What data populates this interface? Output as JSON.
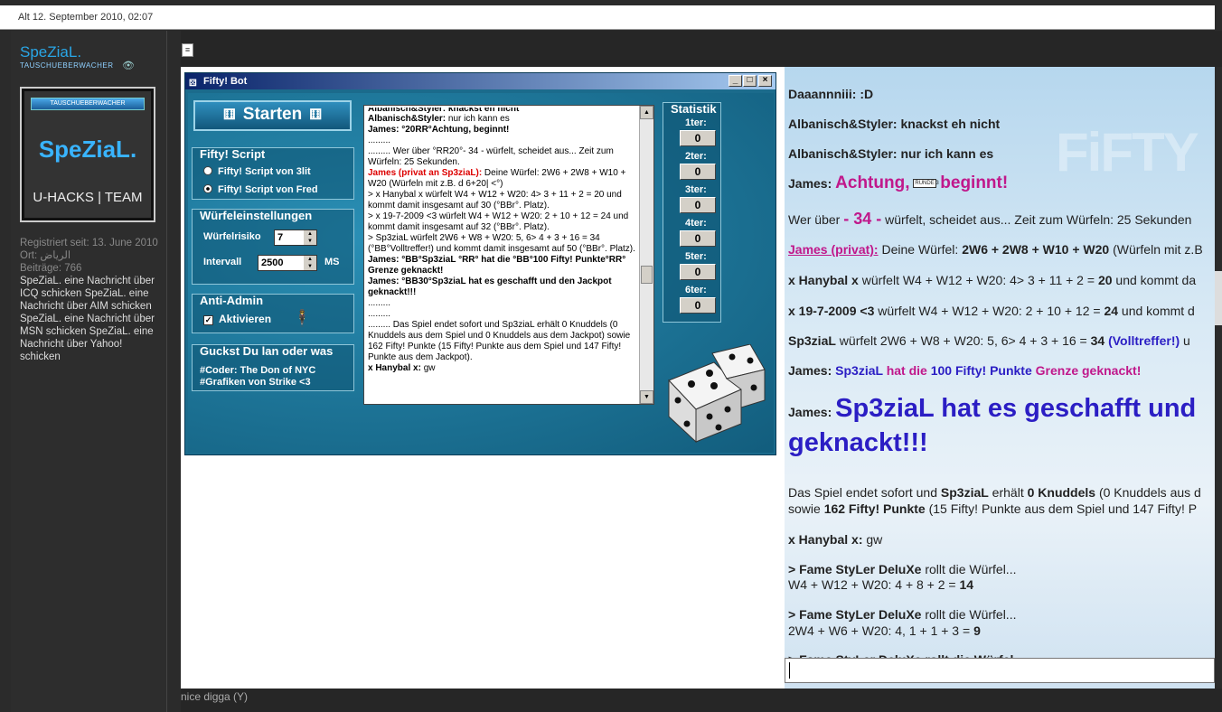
{
  "post": {
    "date": "Alt 12. September 2010, 02:07",
    "signature": "nice digga (Y)"
  },
  "user": {
    "name": "SpeZiaL.",
    "title": "TAUSCHUEBERWACHER",
    "avatar_top": "TAUSCHUEBERWACHER",
    "avatar_name": "SpeZiaL.",
    "avatar_bottom": "U-HACKS | TEAM",
    "registered": "Registriert seit: 13. June 2010",
    "location": "Ort: الرياض",
    "posts": "Beiträge: 766",
    "contact": "SpeZiaL. eine Nachricht über ICQ schicken SpeZiaL. eine Nachricht über AIM schicken SpeZiaL. eine Nachricht über MSN schicken SpeZiaL. eine Nachricht über Yahoo! schicken"
  },
  "bot": {
    "title": "Fifty! Bot",
    "start": "Starten",
    "script_group": "Fifty! Script",
    "script_opt1": "Fifty! Script von 3lit",
    "script_opt2": "Fifty! Script von Fred",
    "dice_group": "Würfeleinstellungen",
    "risk_label": "Würfelrisiko",
    "risk_value": "7",
    "interval_label": "Intervall",
    "interval_value": "2500",
    "interval_unit": "MS",
    "anti_group": "Anti-Admin",
    "anti_label": "Aktivieren",
    "guck_group": "Guckst Du lan oder was",
    "credit1": "#Coder: The Don of NYC",
    "credit2": "#Grafiken von Strike <3",
    "stat_title": "Statistik",
    "stats": [
      {
        "label": "1ter:",
        "value": "0"
      },
      {
        "label": "2ter:",
        "value": "0"
      },
      {
        "label": "3ter:",
        "value": "0"
      },
      {
        "label": "4ter:",
        "value": "0"
      },
      {
        "label": "5ter:",
        "value": "0"
      },
      {
        "label": "6ter:",
        "value": "0"
      }
    ]
  },
  "log": {
    "l0": "Albanisch&Styler: knackst eh nicht",
    "l1a": "Albanisch&Styler:",
    "l1b": " nur ich kann es",
    "l2": "James: °20RR°Achtung,  beginnt!",
    "l3": ".........",
    "l4": "......... Wer über °RR20°- 34 - würfelt, scheidet aus... Zeit zum Würfeln: 25 Sekunden.",
    "l5a": "James (privat an Sp3ziaL):",
    "l5b": " Deine Würfel: 2W6 + 2W8 + W10 + W20 (Würfeln mit z.B. d 6+20| <°)",
    "l6": "> x Hanybal x würfelt W4 + W12 + W20: 4> 3 + 11 + 2 = 20 und kommt damit insgesamt auf 30 (°BBr°. Platz).",
    "l7": "> x 19-7-2009 <3 würfelt W4 + W12 + W20: 2 + 10 + 12 = 24 und kommt damit insgesamt auf 32 (°BBr°. Platz).",
    "l8": "> Sp3ziaL würfelt 2W6 + W8 + W20: 5, 6> 4 + 3 + 16 = 34 (°BB°Volltreffer!) und kommt damit insgesamt auf 50 (°BBr°. Platz).",
    "l9": "James: °BB°Sp3ziaL °RR° hat die °BB°100 Fifty! Punkte°RR° Grenze geknackt!",
    "l10": "James: °BB30°Sp3ziaL  hat es geschafft und den Jackpot geknackt!!!",
    "l11": ".........",
    "l12": ".........",
    "l13": "......... Das Spiel endet sofort und Sp3ziaL  erhält 0 Knuddels (0 Knuddels aus dem Spiel und 0 Knuddels aus dem Jackpot) sowie 162 Fifty! Punkte (15 Fifty! Punkte aus dem Spiel und 147 Fifty! Punkte aus dem Jackpot).",
    "l14a": "x Hanybal x:",
    "l14b": " gw"
  },
  "chat": {
    "c0": "Daaannniii: :D",
    "c1": "Albanisch&Styler: knackst eh nicht",
    "c2": "Albanisch&Styler: nur ich kann es",
    "c3a": "James: ",
    "c3b": "Achtung,",
    "c3c": "beginnt!",
    "c3icon": "RUNDE 3",
    "c4a": "Wer über ",
    "c4b": "- 34 -",
    "c4c": " würfelt, scheidet aus... Zeit zum Würfeln: 25 Sekunden",
    "c5a": "James (privat):",
    "c5b": " Deine Würfel: ",
    "c5c": "2W6 + 2W8 + W10 + W20",
    "c5d": " (Würfeln mit z.B",
    "c6a": "x Hanybal x",
    "c6b": " würfelt W4 + W12 + W20: 4> 3 + 11 + 2 = ",
    "c6c": "20",
    "c6d": " und kommt da",
    "c7a": "x 19-7-2009 <3",
    "c7b": " würfelt W4 + W12 + W20: 2 + 10 + 12 = ",
    "c7c": "24",
    "c7d": " und kommt d",
    "c8a": "Sp3ziaL",
    "c8b": " würfelt 2W6 + W8 + W20: 5, 6> 4 + 3 + 16 = ",
    "c8c": "34",
    "c8d": "(Volltreffer!)",
    "c8e": " u",
    "c9a": "James: ",
    "c9b": "Sp3ziaL",
    "c9c": " hat die ",
    "c9d": "100 Fifty! Punkte",
    "c9e": " Grenze geknackt!",
    "c10a": "James: ",
    "c10b": "Sp3ziaL hat es geschafft und",
    "c10c": "geknackt!!!",
    "c11a": "Das Spiel endet sofort und ",
    "c11b": "Sp3ziaL",
    "c11c": " erhält ",
    "c11d": "0 Knuddels",
    "c11e": " (0 Knuddels aus d",
    "c12a": "sowie ",
    "c12b": "162 Fifty! Punkte",
    "c12c": " (15 Fifty! Punkte aus dem Spiel und 147 Fifty! P",
    "c13a": "x Hanybal x:",
    "c13b": " gw",
    "c14a": "> Fame StyLer DeluXe",
    "c14b": " rollt die Würfel...",
    "c15a": "W4 + W12 + W20: 4 + 8 + 2 = ",
    "c15b": "14",
    "c16a": "> Fame StyLer DeluXe",
    "c16b": " rollt die Würfel...",
    "c17a": "2W4 + W6 + W20: 4, 1 + 1 + 3 = ",
    "c17b": "9",
    "c18": "> Fame StyLer DeluXe rollt die Würfel"
  }
}
